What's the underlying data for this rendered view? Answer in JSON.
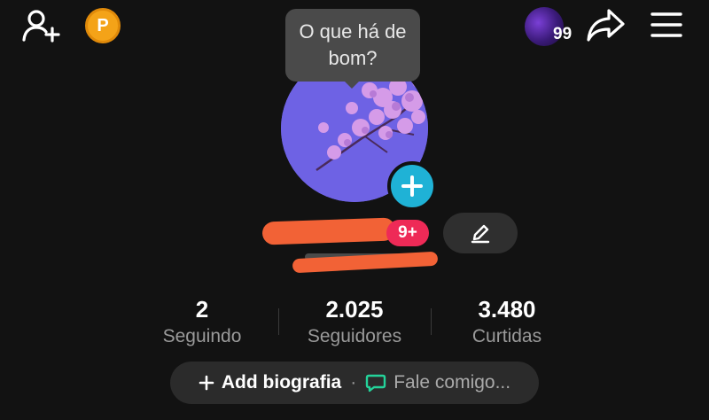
{
  "header": {
    "avatar_count": "99"
  },
  "tooltip": {
    "text": "O que há de bom?"
  },
  "profile": {
    "notification_badge": "9+"
  },
  "stats": [
    {
      "value": "2",
      "label": "Seguindo"
    },
    {
      "value": "2.025",
      "label": "Seguidores"
    },
    {
      "value": "3.480",
      "label": "Curtidas"
    }
  ],
  "bio": {
    "add_label": "Add biografia",
    "separator": "·",
    "message_label": "Fale comigo..."
  },
  "colors": {
    "background": "#121212",
    "coin": "#f4a318",
    "add_photo": "#1fb2d6",
    "badge": "#ee2a57",
    "message_icon": "#24d39a"
  },
  "icons": {
    "add_user": "person-plus-icon",
    "coin": "coin-p-icon",
    "share": "share-arrow-icon",
    "menu": "hamburger-menu-icon",
    "edit": "pencil-icon",
    "add_photo": "plus-icon",
    "message": "chat-bubble-icon"
  }
}
